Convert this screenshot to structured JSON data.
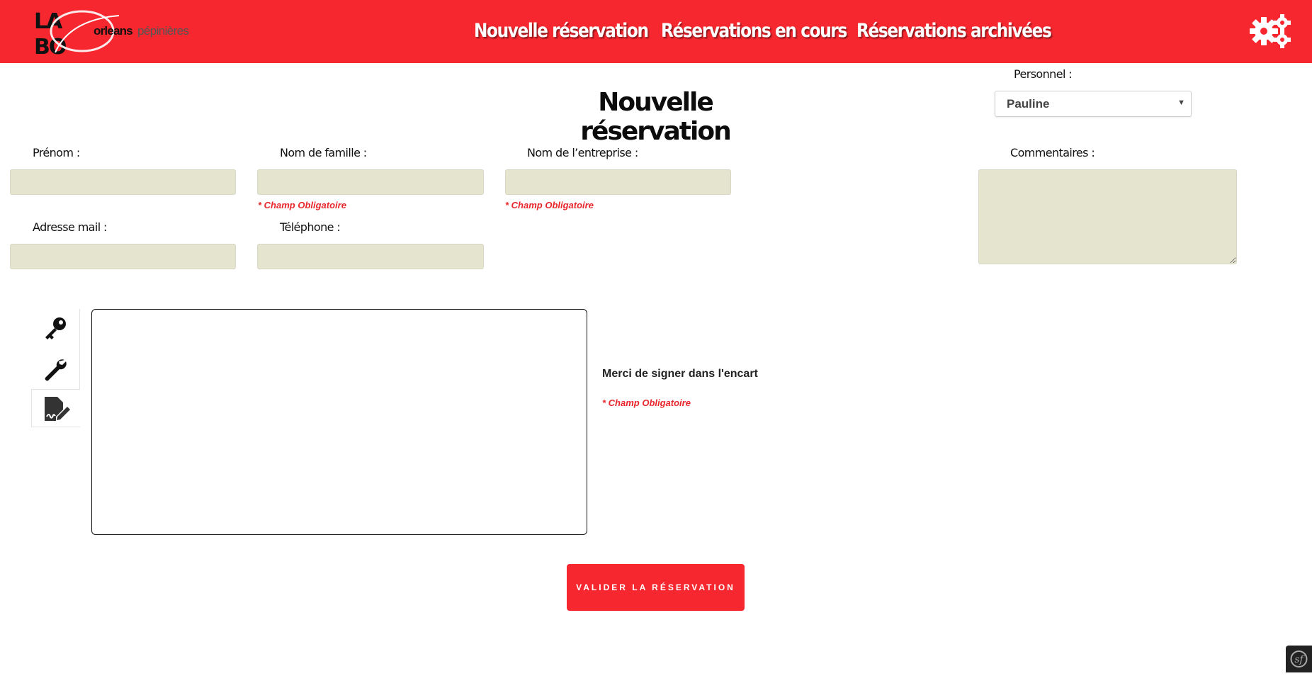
{
  "header": {
    "brand": "LA BO orleans pépinières",
    "nav": [
      "Nouvelle réservation",
      "Réservations en cours",
      "Réservations archivées"
    ],
    "settings_icon": "gears-icon",
    "colors": {
      "bar": "#f6272f",
      "text": "#ffffff"
    }
  },
  "page": {
    "title": "Nouvelle réservation"
  },
  "personnel": {
    "label": "Personnel :",
    "selected": "Pauline"
  },
  "form": {
    "prenom": {
      "label": "Prénom :",
      "value": ""
    },
    "nom": {
      "label": "Nom de famille :",
      "value": "",
      "required": "* Champ Obligatoire"
    },
    "entreprise": {
      "label": "Nom de l’entreprise :",
      "value": "",
      "required": "* Champ Obligatoire"
    },
    "email": {
      "label": "Adresse mail :",
      "value": ""
    },
    "telephone": {
      "label": "Téléphone :",
      "value": ""
    },
    "commentaires": {
      "label": "Commentaires :",
      "value": ""
    }
  },
  "signature": {
    "tools": [
      "key-icon",
      "wrench-icon",
      "signature-icon"
    ],
    "active_tool": "signature-icon",
    "message": "Merci de signer dans l'encart",
    "required": "* Champ Obligatoire"
  },
  "actions": {
    "submit": "VALIDER LA RÉSERVATION"
  },
  "colors": {
    "accent": "#f6272f",
    "input_bg": "#e5e4cf",
    "required": "#e8262c"
  }
}
